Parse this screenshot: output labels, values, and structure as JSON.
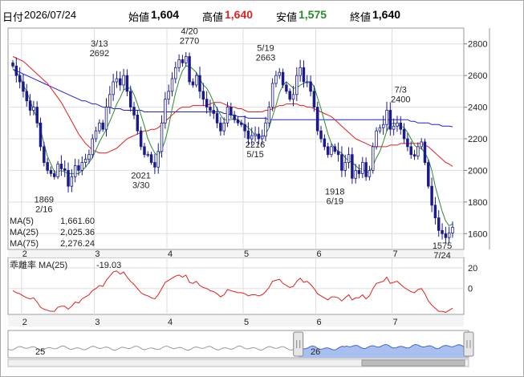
{
  "header": {
    "date_label": "日付",
    "date": "2026/07/24",
    "open_label": "始値",
    "open": "1,604",
    "high_label": "高値",
    "high": "1,640",
    "low_label": "安値",
    "low": "1,575",
    "close_label": "終値",
    "close": "1,640"
  },
  "legend": [
    {
      "name": "MA(5)",
      "value": "1,661.60",
      "color": "#2e8b2e"
    },
    {
      "name": "MA(25)",
      "value": "2,025.36",
      "color": "#e02020"
    },
    {
      "name": "MA(75)",
      "value": "2,276.24",
      "color": "#2020e0"
    }
  ],
  "deviation": {
    "label": "乖離率 MA(25)",
    "value": "-19.03",
    "color": "#e02020"
  },
  "colors": {
    "up": "#ffffff",
    "down": "#1a1a8c",
    "candle_border": "#1a1a8c",
    "nav_fill": "#a8c0f0"
  },
  "chart_data": [
    {
      "type": "candlestick",
      "x_months": [
        "2",
        "3",
        "4",
        "5",
        "6",
        "7"
      ],
      "ylim": [
        1500,
        2900
      ],
      "y_ticks": [
        1600,
        1800,
        2000,
        2200,
        2400,
        2600,
        2800
      ],
      "grid": true,
      "annotations": [
        {
          "date": "2/16",
          "price": "1869",
          "pos": "below"
        },
        {
          "date": "3/13",
          "price": "2692",
          "pos": "above"
        },
        {
          "date": "3/30",
          "price": "2021",
          "pos": "below"
        },
        {
          "date": "4/20",
          "price": "2770",
          "pos": "above"
        },
        {
          "date": "5/15",
          "price": "2216",
          "pos": "below"
        },
        {
          "date": "5/19",
          "price": "2663",
          "pos": "above"
        },
        {
          "date": "6/19",
          "price": "1918",
          "pos": "below"
        },
        {
          "date": "7/3",
          "price": "2400",
          "pos": "above"
        },
        {
          "date": "7/24",
          "price": "1575",
          "pos": "below"
        }
      ],
      "close": [
        2660,
        2600,
        2560,
        2500,
        2440,
        2380,
        2400,
        2300,
        2150,
        2050,
        2000,
        1980,
        1960,
        2040,
        2010,
        2000,
        1900,
        1960,
        2030,
        2000,
        2050,
        2070,
        2100,
        2200,
        2250,
        2300,
        2260,
        2400,
        2480,
        2560,
        2580,
        2540,
        2600,
        2500,
        2400,
        2350,
        2250,
        2150,
        2100,
        2100,
        2050,
        2021,
        2120,
        2300,
        2450,
        2500,
        2580,
        2650,
        2700,
        2680,
        2720,
        2560,
        2540,
        2600,
        2500,
        2450,
        2400,
        2380,
        2360,
        2300,
        2250,
        2300,
        2400,
        2350,
        2320,
        2300,
        2290,
        2250,
        2200,
        2220,
        2230,
        2200,
        2216,
        2300,
        2400,
        2550,
        2600,
        2620,
        2540,
        2500,
        2450,
        2480,
        2600,
        2650,
        2560,
        2560,
        2500,
        2400,
        2250,
        2200,
        2150,
        2100,
        2150,
        2120,
        2100,
        2000,
        2050,
        2100,
        1950,
        2000,
        1980,
        2050,
        1960,
        2000,
        2150,
        2250,
        2270,
        2290,
        2380,
        2260,
        2280,
        2300,
        2260,
        2200,
        2150,
        2100,
        2090,
        2150,
        2180,
        2050,
        1900,
        1780,
        1700,
        1620,
        1600,
        1575,
        1604,
        1640
      ],
      "ma5": [
        2640,
        2620,
        2600,
        2540,
        2500,
        2440,
        2380,
        2330,
        2260,
        2170,
        2090,
        2040,
        1990,
        1990,
        2000,
        1990,
        1980,
        1980,
        1980,
        1980,
        2000,
        2020,
        2050,
        2080,
        2130,
        2180,
        2220,
        2260,
        2310,
        2360,
        2420,
        2460,
        2510,
        2520,
        2520,
        2480,
        2420,
        2350,
        2280,
        2200,
        2150,
        2110,
        2090,
        2130,
        2190,
        2280,
        2390,
        2490,
        2570,
        2630,
        2660,
        2660,
        2640,
        2620,
        2580,
        2540,
        2520,
        2480,
        2430,
        2390,
        2350,
        2320,
        2320,
        2320,
        2330,
        2320,
        2300,
        2290,
        2270,
        2250,
        2220,
        2220,
        2210,
        2230,
        2270,
        2340,
        2410,
        2490,
        2540,
        2560,
        2540,
        2520,
        2520,
        2540,
        2550,
        2560,
        2560,
        2530,
        2460,
        2390,
        2310,
        2230,
        2170,
        2140,
        2120,
        2110,
        2080,
        2060,
        2050,
        2030,
        2010,
        2010,
        1990,
        1990,
        2030,
        2080,
        2120,
        2180,
        2250,
        2290,
        2300,
        2290,
        2280,
        2270,
        2240,
        2200,
        2160,
        2140,
        2140,
        2110,
        2070,
        2000,
        1900,
        1820,
        1740,
        1680,
        1650,
        1662
      ],
      "ma25": [
        2720,
        2710,
        2700,
        2690,
        2670,
        2650,
        2630,
        2610,
        2590,
        2570,
        2550,
        2520,
        2490,
        2460,
        2430,
        2390,
        2350,
        2310,
        2270,
        2230,
        2200,
        2170,
        2150,
        2130,
        2120,
        2110,
        2110,
        2110,
        2120,
        2130,
        2140,
        2160,
        2180,
        2200,
        2210,
        2220,
        2230,
        2240,
        2250,
        2250,
        2260,
        2260,
        2270,
        2290,
        2310,
        2330,
        2350,
        2370,
        2390,
        2400,
        2400,
        2400,
        2410,
        2410,
        2410,
        2410,
        2410,
        2420,
        2430,
        2430,
        2430,
        2420,
        2410,
        2400,
        2400,
        2390,
        2390,
        2380,
        2370,
        2370,
        2370,
        2370,
        2370,
        2380,
        2380,
        2390,
        2400,
        2410,
        2410,
        2420,
        2420,
        2420,
        2420,
        2410,
        2410,
        2400,
        2400,
        2390,
        2380,
        2370,
        2360,
        2350,
        2340,
        2320,
        2300,
        2280,
        2260,
        2240,
        2220,
        2200,
        2190,
        2180,
        2170,
        2160,
        2150,
        2150,
        2150,
        2150,
        2150,
        2160,
        2160,
        2160,
        2170,
        2170,
        2170,
        2170,
        2170,
        2170,
        2170,
        2160,
        2150,
        2130,
        2110,
        2090,
        2070,
        2050,
        2040,
        2025
      ],
      "ma75": [
        2640,
        2630,
        2620,
        2610,
        2600,
        2590,
        2580,
        2570,
        2560,
        2550,
        2540,
        2530,
        2520,
        2510,
        2500,
        2490,
        2480,
        2470,
        2460,
        2450,
        2440,
        2440,
        2430,
        2420,
        2420,
        2410,
        2400,
        2400,
        2400,
        2390,
        2390,
        2390,
        2380,
        2380,
        2380,
        2380,
        2380,
        2380,
        2370,
        2370,
        2370,
        2370,
        2370,
        2370,
        2370,
        2370,
        2370,
        2370,
        2370,
        2370,
        2370,
        2370,
        2370,
        2370,
        2370,
        2370,
        2370,
        2370,
        2370,
        2370,
        2370,
        2360,
        2360,
        2350,
        2350,
        2340,
        2340,
        2340,
        2330,
        2330,
        2330,
        2330,
        2330,
        2330,
        2320,
        2320,
        2320,
        2320,
        2320,
        2320,
        2320,
        2320,
        2320,
        2320,
        2320,
        2320,
        2320,
        2320,
        2320,
        2320,
        2320,
        2320,
        2320,
        2320,
        2320,
        2320,
        2320,
        2320,
        2320,
        2320,
        2320,
        2320,
        2320,
        2320,
        2320,
        2320,
        2320,
        2320,
        2320,
        2320,
        2320,
        2320,
        2320,
        2320,
        2320,
        2310,
        2310,
        2300,
        2300,
        2300,
        2300,
        2290,
        2290,
        2290,
        2280,
        2280,
        2280,
        2276
      ]
    },
    {
      "type": "line",
      "ylim": [
        -25,
        30
      ],
      "y_ticks": [
        0,
        20
      ],
      "values": [
        -2,
        -4,
        -5,
        -7,
        -9,
        -10,
        -9,
        -13,
        -18,
        -20,
        -21,
        -22,
        -22,
        -18,
        -17,
        -17,
        -20,
        -17,
        -13,
        -14,
        -10,
        -8,
        -6,
        -2,
        0,
        3,
        2,
        8,
        12,
        16,
        17,
        14,
        16,
        11,
        7,
        4,
        0,
        -4,
        -6,
        -7,
        -9,
        -10,
        -6,
        0,
        6,
        8,
        10,
        12,
        13,
        11,
        13,
        6,
        5,
        7,
        3,
        1,
        0,
        -2,
        -3,
        -5,
        -8,
        -6,
        -1,
        -2,
        -3,
        -4,
        -4,
        -5,
        -7,
        -6,
        -6,
        -7,
        -6,
        -3,
        1,
        7,
        8,
        9,
        5,
        3,
        1,
        2,
        7,
        10,
        6,
        7,
        4,
        0,
        -5,
        -7,
        -9,
        -11,
        -8,
        -8,
        -9,
        -12,
        -9,
        -6,
        -11,
        -9,
        -9,
        -6,
        -10,
        -7,
        0,
        5,
        6,
        7,
        11,
        5,
        6,
        7,
        4,
        1,
        -1,
        -3,
        -4,
        -1,
        0,
        -5,
        -12,
        -16,
        -19,
        -22,
        -22,
        -23,
        -21,
        -19
      ]
    }
  ],
  "navigator": {
    "year_labels": [
      "25",
      "26"
    ]
  }
}
